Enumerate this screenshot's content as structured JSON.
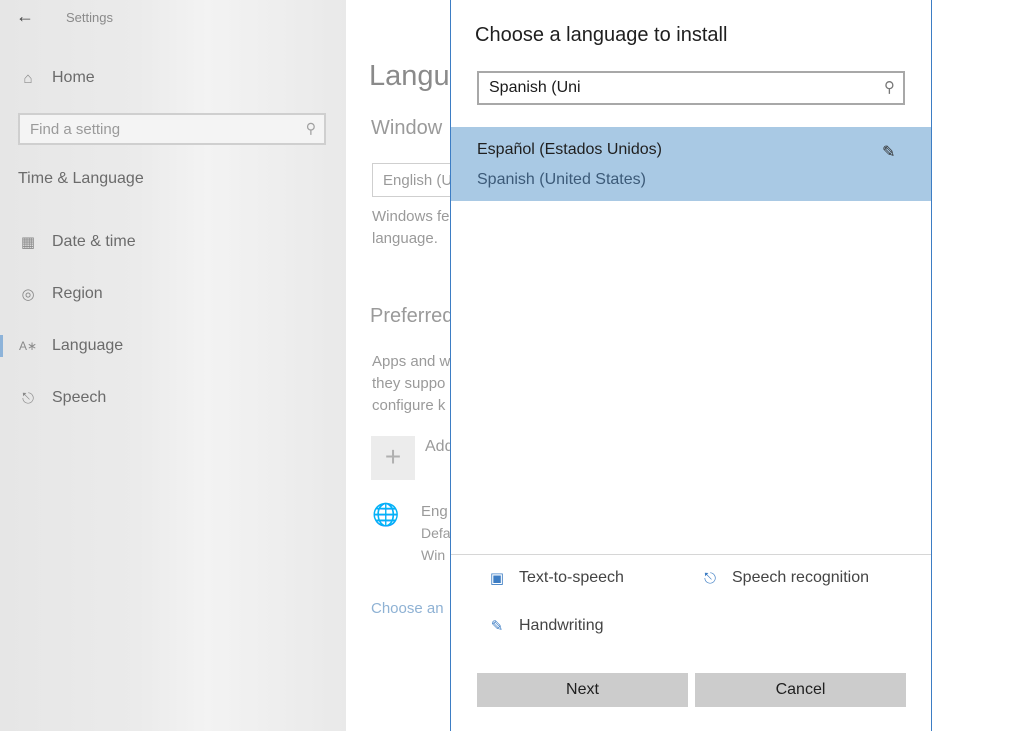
{
  "settings": {
    "window_title": "Settings",
    "home": "Home",
    "search_placeholder": "Find a setting",
    "section": "Time & Language",
    "nav": [
      {
        "label": "Date & time",
        "icon": "calendar-icon"
      },
      {
        "label": "Region",
        "icon": "globe-icon"
      },
      {
        "label": "Language",
        "icon": "language-icon"
      },
      {
        "label": "Speech",
        "icon": "microphone-icon"
      }
    ]
  },
  "main": {
    "title": "Langu",
    "windows_label": "Window",
    "combo_value": "English (U",
    "desc_line1": "Windows fe",
    "desc_line2": "language.",
    "preferred_label": "Preferred",
    "apps_line1": "Apps and w",
    "apps_line2": "they suppo",
    "apps_line3": "configure k",
    "add_text": "Add",
    "lang_item_line1": "Eng",
    "lang_item_line2": "Defa",
    "lang_item_line3": "Win",
    "choose_link": "Choose an"
  },
  "dialog": {
    "title": "Choose a language to install",
    "search_value": "Spanish (Uni",
    "results": [
      {
        "native": "Español (Estados Unidos)",
        "english": "Spanish (United States)",
        "selected": true
      }
    ],
    "features": [
      {
        "label": "Text-to-speech",
        "icon": "text-to-speech-icon"
      },
      {
        "label": "Speech recognition",
        "icon": "microphone-icon"
      },
      {
        "label": "Handwriting",
        "icon": "handwriting-icon"
      }
    ],
    "next_label": "Next",
    "cancel_label": "Cancel"
  },
  "colors": {
    "accent": "#3d7dc4",
    "selection": "#a9c9e4",
    "button": "#cccccc"
  }
}
